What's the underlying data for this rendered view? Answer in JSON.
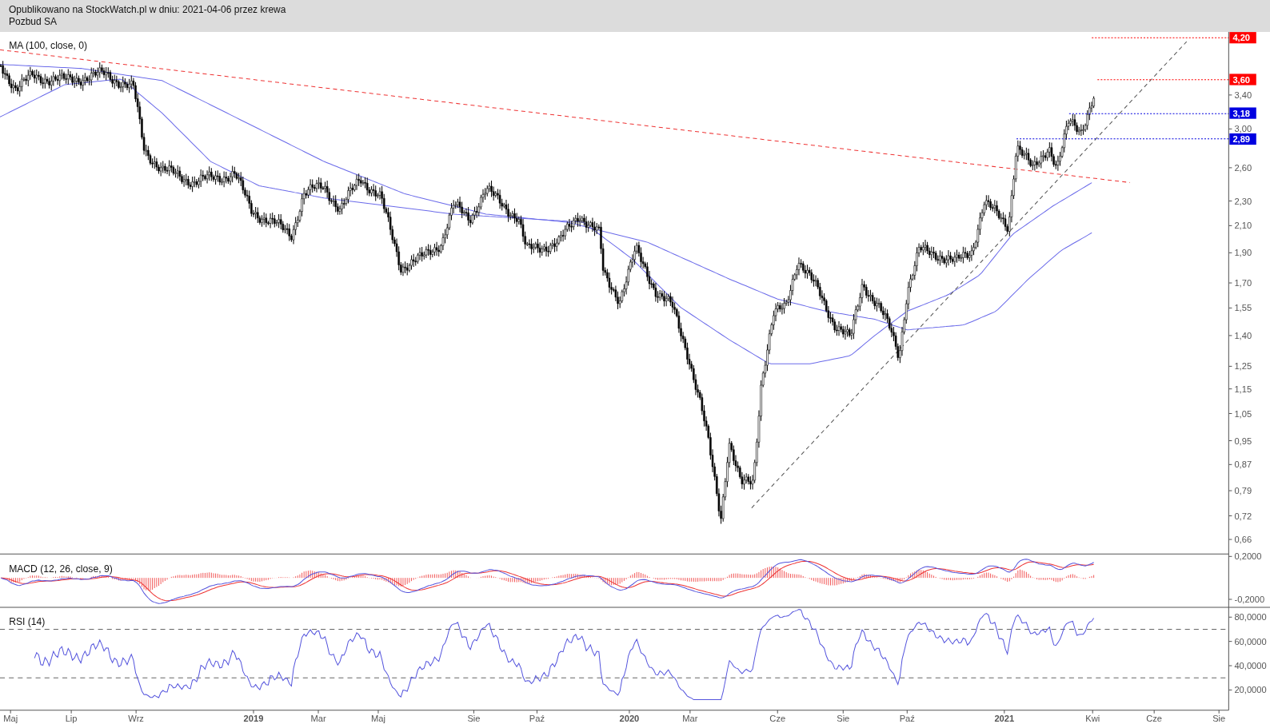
{
  "header": {
    "published": "Opublikowano na StockWatch.pl w dniu: 2021-04-06 przez krewa",
    "instrument": "Pozbud SA"
  },
  "price_panel": {
    "label": "MA (100, close, 0)",
    "ticks": [
      "3,40",
      "3,00",
      "2,60",
      "2,30",
      "2,10",
      "1,90",
      "1,70",
      "1,55",
      "1,40",
      "1,25",
      "1,15",
      "1,05",
      "0,95",
      "0,87",
      "0,79",
      "0,72",
      "0,66"
    ],
    "price_levels": [
      {
        "value": "4,20",
        "color": "#ff0000"
      },
      {
        "value": "3,60",
        "color": "#ff0000"
      },
      {
        "value": "3,18",
        "color": "#0000e0"
      },
      {
        "value": "2,89",
        "color": "#0000e0"
      }
    ]
  },
  "macd_panel": {
    "label": "MACD (12, 26, close, 9)",
    "ticks": [
      "0,2000",
      "-0,2000"
    ]
  },
  "rsi_panel": {
    "label": "RSI (14)",
    "ticks": [
      "80,0000",
      "60,0000",
      "40,0000",
      "20,0000"
    ]
  },
  "x_axis": [
    {
      "label": "Maj",
      "kind": "month"
    },
    {
      "label": "Lip",
      "kind": "month"
    },
    {
      "label": "Wrz",
      "kind": "month"
    },
    {
      "label": "2019",
      "kind": "year"
    },
    {
      "label": "Mar",
      "kind": "month"
    },
    {
      "label": "Maj",
      "kind": "month"
    },
    {
      "label": "Sie",
      "kind": "month"
    },
    {
      "label": "Paź",
      "kind": "month"
    },
    {
      "label": "2020",
      "kind": "year"
    },
    {
      "label": "Mar",
      "kind": "month"
    },
    {
      "label": "Cze",
      "kind": "month"
    },
    {
      "label": "Sie",
      "kind": "month"
    },
    {
      "label": "Paź",
      "kind": "month"
    },
    {
      "label": "2021",
      "kind": "year"
    },
    {
      "label": "Kwi",
      "kind": "month"
    },
    {
      "label": "Cze",
      "kind": "month"
    },
    {
      "label": "Sie",
      "kind": "month"
    }
  ]
}
